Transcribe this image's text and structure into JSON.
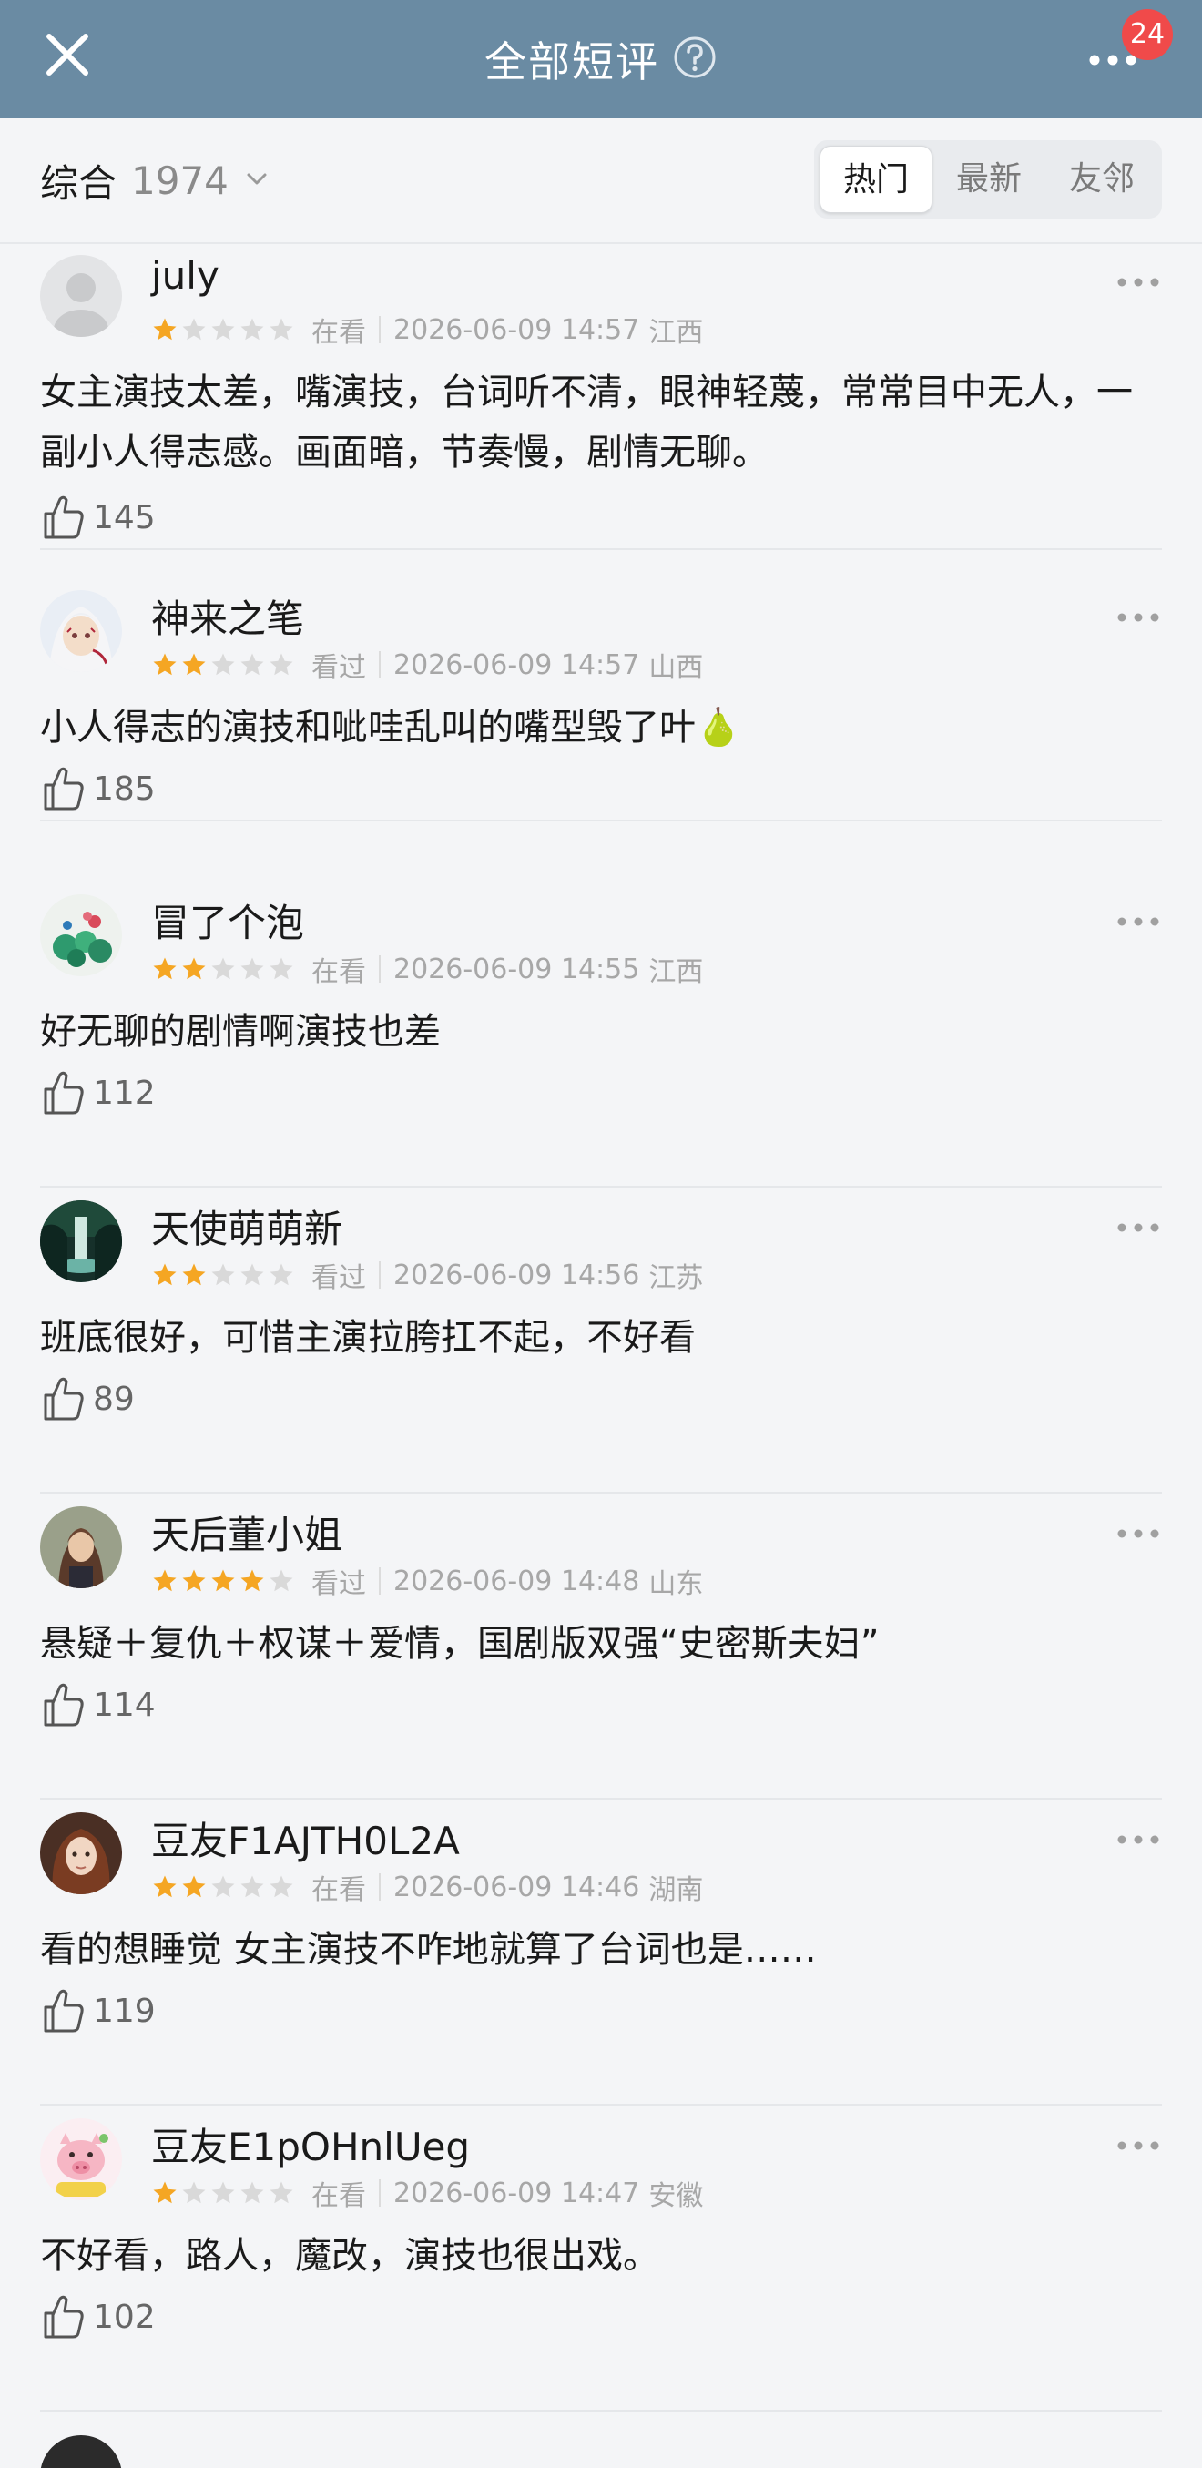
{
  "header": {
    "title": "全部短评",
    "badge_count": "24",
    "close_icon": "close-icon",
    "help_icon": "question-circle-icon",
    "more_icon": "more-dots-icon",
    "bar_color": "#6a8ba3"
  },
  "filter": {
    "sort_label": "综合",
    "sort_count": "1974",
    "tabs": [
      {
        "label": "热门",
        "active": true
      },
      {
        "label": "最新",
        "active": false
      },
      {
        "label": "友邻",
        "active": false
      }
    ]
  },
  "colors": {
    "star_on": "#f5a623",
    "star_off": "#d9d9d9",
    "badge": "#f04a4a"
  },
  "reviews": [
    {
      "user": "july",
      "rating": 1,
      "status": "在看",
      "time": "2026-06-09 14:57",
      "location": "江西",
      "text": "女主演技太差，嘴演技，台词听不清，眼神轻蔑，常常目中无人，一副小人得志感。画面暗，节奏慢，剧情无聊。",
      "likes": "145"
    },
    {
      "user": "神来之笔",
      "rating": 2,
      "status": "看过",
      "time": "2026-06-09 14:57",
      "location": "山西",
      "text": "小人得志的演技和呲哇乱叫的嘴型毁了叶🍐",
      "likes": "185"
    },
    {
      "user": "冒了个泡",
      "rating": 2,
      "status": "在看",
      "time": "2026-06-09 14:55",
      "location": "江西",
      "text": "好无聊的剧情啊演技也差",
      "likes": "112"
    },
    {
      "user": "天使萌萌新",
      "rating": 2,
      "status": "看过",
      "time": "2026-06-09 14:56",
      "location": "江苏",
      "text": "班底很好，可惜主演拉胯扛不起，不好看",
      "likes": "89"
    },
    {
      "user": "天后董小姐",
      "rating": 4,
      "status": "看过",
      "time": "2026-06-09 14:48",
      "location": "山东",
      "text": "悬疑＋复仇＋权谋＋爱情，国剧版双强“史密斯夫妇”",
      "likes": "114"
    },
    {
      "user": "豆友F1AJTH0L2A",
      "rating": 2,
      "status": "在看",
      "time": "2026-06-09 14:46",
      "location": "湖南",
      "text": "看的想睡觉 女主演技不咋地就算了台词也是……",
      "likes": "119"
    },
    {
      "user": "豆友E1pOHnlUeg",
      "rating": 1,
      "status": "在看",
      "time": "2026-06-09 14:47",
      "location": "安徽",
      "text": "不好看，路人，魔改，演技也很出戏。",
      "likes": "102"
    }
  ]
}
